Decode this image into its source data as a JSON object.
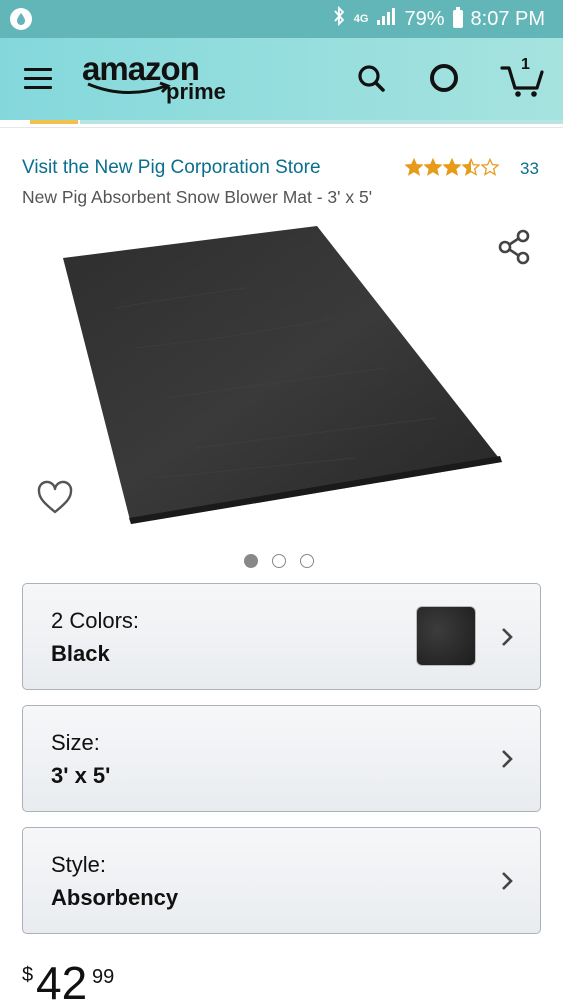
{
  "status_bar": {
    "network": "4G",
    "battery": "79%",
    "time": "8:07 PM"
  },
  "header": {
    "logo_word": "amazon",
    "logo_prime": "prime",
    "cart_count": "1",
    "icons": [
      "menu-icon",
      "search-icon",
      "alexa-icon",
      "cart-icon"
    ]
  },
  "product": {
    "store_link": "Visit the New Pig Corporation Store",
    "rating_stars": 3.5,
    "rating_count": "33",
    "title": "New Pig Absorbent Snow Blower Mat - 3' x 5'",
    "image_count": 3,
    "active_image": 0
  },
  "options": [
    {
      "label": "2 Colors:",
      "value": "Black",
      "has_swatch": true
    },
    {
      "label": "Size:",
      "value": "3' x 5'",
      "has_swatch": false
    },
    {
      "label": "Style:",
      "value": "Absorbency",
      "has_swatch": false
    }
  ],
  "price": {
    "symbol": "$",
    "whole": "42",
    "fraction": "99"
  },
  "colors": {
    "status_bar": "#62b6b7",
    "header": "#84d8dc",
    "link": "#0a6e8f",
    "star": "#e69b1a"
  }
}
